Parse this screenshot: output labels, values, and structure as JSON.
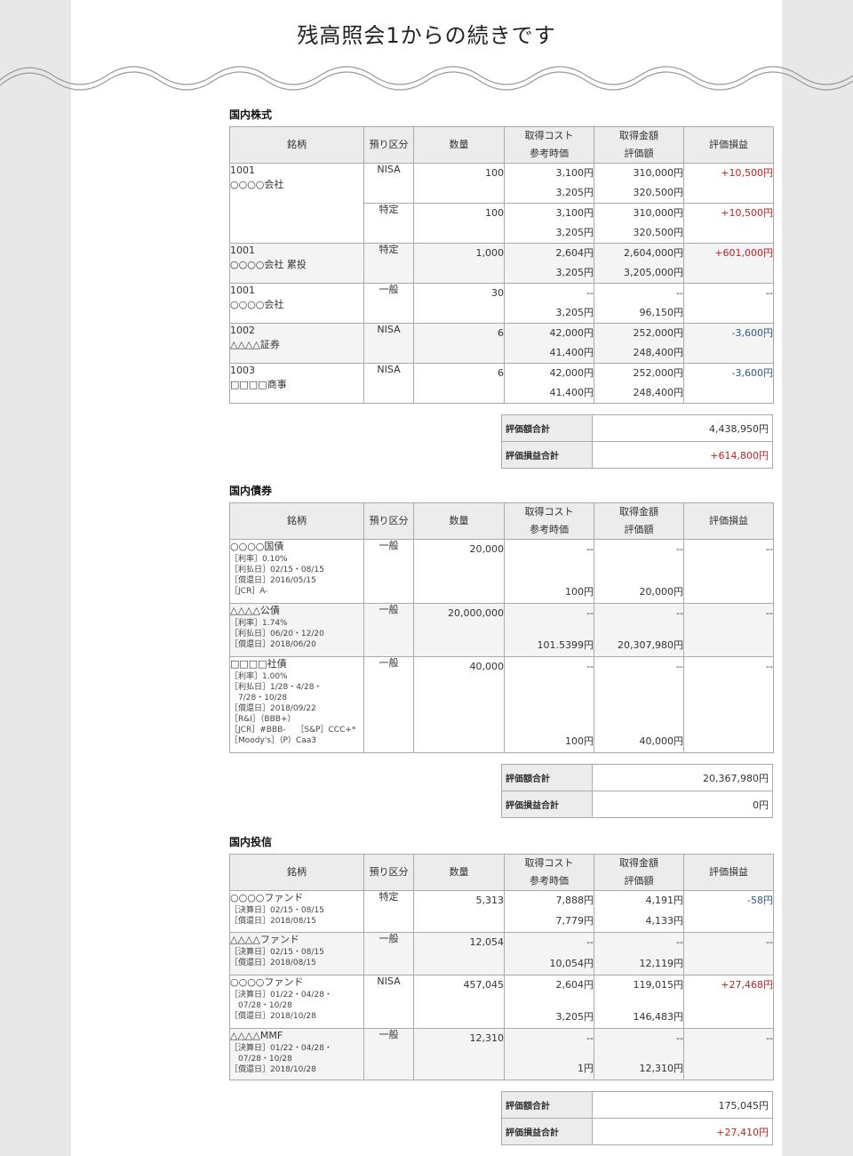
{
  "heading": "残高照会1からの続きです",
  "headers": [
    "銘柄",
    "預り区分",
    "数量",
    "取得コスト",
    "参考時価",
    "取得金額",
    "評価額",
    "評価損益"
  ],
  "sections": [
    {
      "title": "国内株式",
      "groups": [
        {
          "name": "1001",
          "name2": "○○○○会社",
          "details": [],
          "rows": [
            {
              "acct": "NISA",
              "qty": "100",
              "cost": "3,100円",
              "price": "3,205円",
              "acq": "310,000円",
              "val": "320,500円",
              "pl": "+10,500円",
              "plc": "pos"
            },
            {
              "acct": "特定",
              "qty": "100",
              "cost": "3,100円",
              "price": "3,205円",
              "acq": "310,000円",
              "val": "320,500円",
              "pl": "+10,500円",
              "plc": "pos"
            }
          ]
        },
        {
          "name": "1001",
          "name2": "○○○○会社 累投",
          "details": [],
          "rows": [
            {
              "acct": "特定",
              "qty": "1,000",
              "cost": "2,604円",
              "price": "3,205円",
              "acq": "2,604,000円",
              "val": "3,205,000円",
              "pl": "+601,000円",
              "plc": "pos"
            }
          ]
        },
        {
          "name": "1001",
          "name2": "○○○○会社",
          "details": [],
          "rows": [
            {
              "acct": "一般",
              "qty": "30",
              "cost": "--",
              "price": "3,205円",
              "acq": "--",
              "val": "96,150円",
              "pl": "--",
              "plc": ""
            }
          ]
        },
        {
          "name": "1002",
          "name2": "△△△△証券",
          "details": [],
          "rows": [
            {
              "acct": "NISA",
              "qty": "6",
              "cost": "42,000円",
              "price": "41,400円",
              "acq": "252,000円",
              "val": "248,400円",
              "pl": "-3,600円",
              "plc": "neg"
            }
          ]
        },
        {
          "name": "1003",
          "name2": "□□□□商事",
          "details": [],
          "rows": [
            {
              "acct": "NISA",
              "qty": "6",
              "cost": "42,000円",
              "price": "41,400円",
              "acq": "252,000円",
              "val": "248,400円",
              "pl": "-3,600円",
              "plc": "neg"
            }
          ]
        }
      ],
      "summary": [
        {
          "label": "評価額合計",
          "value": "4,438,950円",
          "cls": ""
        },
        {
          "label": "評価損益合計",
          "value": "+614,800円",
          "cls": "pos"
        }
      ]
    },
    {
      "title": "国内債券",
      "groups": [
        {
          "name": "○○○○国債",
          "name2": "",
          "details": [
            "［利率］0.10%",
            "［利払日］02/15・08/15",
            "［償還日］2016/05/15",
            "［JCR］A-"
          ],
          "rows": [
            {
              "acct": "一般",
              "qty": "20,000",
              "cost": "--",
              "price": "100円",
              "acq": "--",
              "val": "20,000円",
              "pl": "--",
              "plc": ""
            }
          ]
        },
        {
          "name": "△△△△公債",
          "name2": "",
          "details": [
            "［利率］1.74%",
            "［利払日］06/20・12/20",
            "［償還日］2018/06/20"
          ],
          "rows": [
            {
              "acct": "一般",
              "qty": "20,000,000",
              "cost": "--",
              "price": "101.5399円",
              "acq": "--",
              "val": "20,307,980円",
              "pl": "--",
              "plc": ""
            }
          ]
        },
        {
          "name": "□□□□社債",
          "name2": "",
          "details": [
            "［利率］1.00%",
            "［利払日］1/28・4/28・",
            "　7/28・10/28",
            "［償還日］2018/09/22",
            "［R&I］（BBB+）",
            "［JCR］#BBB-　 ［S&P］CCC+*",
            "［Moody's］（P）Caa3"
          ],
          "rows": [
            {
              "acct": "一般",
              "qty": "40,000",
              "cost": "--",
              "price": "100円",
              "acq": "--",
              "val": "40,000円",
              "pl": "--",
              "plc": ""
            }
          ]
        }
      ],
      "summary": [
        {
          "label": "評価額合計",
          "value": "20,367,980円",
          "cls": ""
        },
        {
          "label": "評価損益合計",
          "value": "0円",
          "cls": ""
        }
      ]
    },
    {
      "title": "国内投信",
      "groups": [
        {
          "name": "○○○○ファンド",
          "name2": "",
          "details": [
            "［決算日］02/15・08/15",
            "［償還日］2018/08/15"
          ],
          "rows": [
            {
              "acct": "特定",
              "qty": "5,313",
              "cost": "7,888円",
              "price": "7,779円",
              "acq": "4,191円",
              "val": "4,133円",
              "pl": "-58円",
              "plc": "neg"
            }
          ]
        },
        {
          "name": "△△△△ファンド",
          "name2": "",
          "details": [
            "［決算日］02/15・08/15",
            "［償還日］2018/08/15"
          ],
          "rows": [
            {
              "acct": "一般",
              "qty": "12,054",
              "cost": "--",
              "price": "10,054円",
              "acq": "--",
              "val": "12,119円",
              "pl": "--",
              "plc": ""
            }
          ]
        },
        {
          "name": "○○○○ファンド",
          "name2": "",
          "details": [
            "［決算日］01/22・04/28・",
            "　07/28・10/28",
            "［償還日］2018/10/28"
          ],
          "rows": [
            {
              "acct": "NISA",
              "qty": "457,045",
              "cost": "2,604円",
              "price": "3,205円",
              "acq": "119,015円",
              "val": "146,483円",
              "pl": "+27,468円",
              "plc": "pos"
            }
          ]
        },
        {
          "name": "△△△△MMF",
          "name2": "",
          "details": [
            "［決算日］01/22・04/28・",
            "　07/28・10/28",
            "［償還日］2018/10/28"
          ],
          "rows": [
            {
              "acct": "一般",
              "qty": "12,310",
              "cost": "--",
              "price": "1円",
              "acq": "--",
              "val": "12,310円",
              "pl": "--",
              "plc": ""
            }
          ]
        }
      ],
      "summary": [
        {
          "label": "評価額合計",
          "value": "175,045円",
          "cls": ""
        },
        {
          "label": "評価損益合計",
          "value": "+27,410円",
          "cls": "pos"
        }
      ]
    }
  ]
}
